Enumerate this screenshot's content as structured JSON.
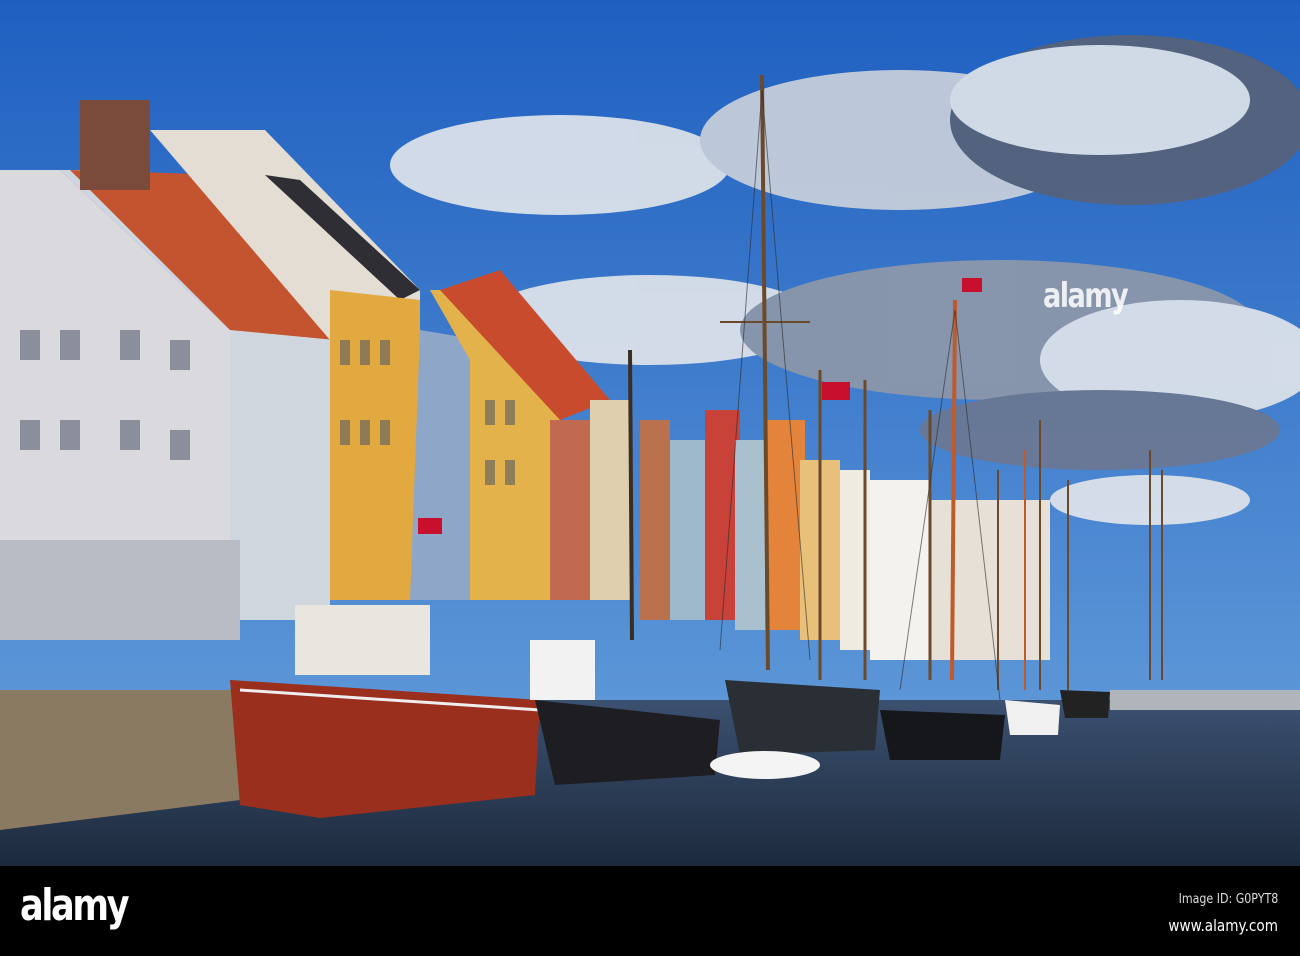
{
  "photo": {
    "subject": "Nyhavn canal with historic sailing ships and colourful townhouses",
    "watermark": "alamy"
  },
  "footer": {
    "logo": "alamy",
    "image_id": "Image ID: G0PYT8",
    "website": "www.alamy.com"
  },
  "colors": {
    "sky": "#2f6fc4",
    "water": "#25344a",
    "footer": "#000000"
  }
}
